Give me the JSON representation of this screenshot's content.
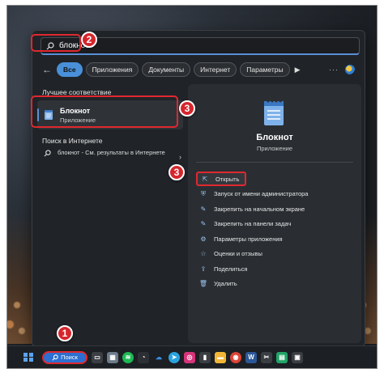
{
  "search": {
    "value": "блокнот"
  },
  "tabs": [
    {
      "label": "Все",
      "active": true
    },
    {
      "label": "Приложения"
    },
    {
      "label": "Документы"
    },
    {
      "label": "Интернет"
    },
    {
      "label": "Параметры"
    }
  ],
  "best_match": {
    "section_title": "Лучшее соответствие",
    "title": "Блокнот",
    "subtitle": "Приложение",
    "icon": "notepad-icon"
  },
  "web": {
    "section_title": "Поиск в Интернете",
    "item_text": "блокнот",
    "item_suffix": " - См. результаты в Интернете"
  },
  "details": {
    "app_name": "Блокнот",
    "app_type": "Приложение",
    "actions": [
      {
        "label": "Открыть",
        "icon": "open-icon"
      },
      {
        "label": "Запуск от имени администратора",
        "icon": "shield-icon"
      },
      {
        "label": "Закрепить на начальном экране",
        "icon": "pin-icon"
      },
      {
        "label": "Закрепить на панели задач",
        "icon": "pin-icon"
      },
      {
        "label": "Параметры приложения",
        "icon": "gear-icon"
      },
      {
        "label": "Оценки и отзывы",
        "icon": "star-icon"
      },
      {
        "label": "Поделиться",
        "icon": "share-icon"
      },
      {
        "label": "Удалить",
        "icon": "trash-icon"
      }
    ]
  },
  "taskbar": {
    "search_label": "Поиск"
  },
  "badges": {
    "one": "1",
    "two": "2",
    "three_a": "3",
    "three_b": "3"
  },
  "colors": {
    "accent": "#4a90d9",
    "highlight": "#e0282f"
  }
}
